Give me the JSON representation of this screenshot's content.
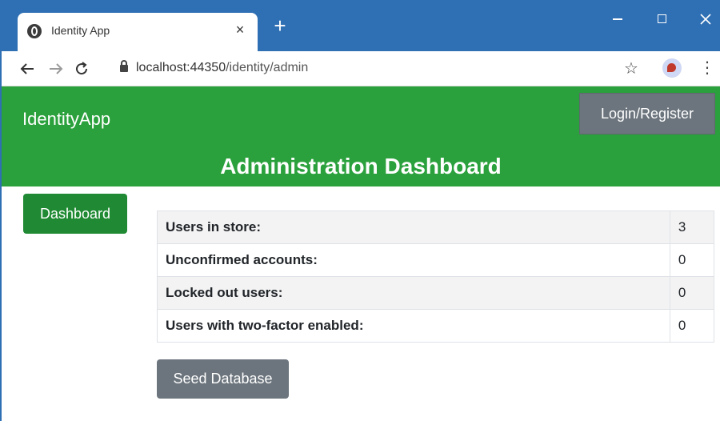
{
  "browser": {
    "tab_title": "Identity App",
    "tab_close": "×",
    "new_tab": "+",
    "url_host": "localhost:44350",
    "url_path": "/identity/admin",
    "icons": [
      "globe-icon",
      "close-icon",
      "plus-icon",
      "minimize-icon",
      "maximize-icon",
      "window-close-icon",
      "back-arrow-icon",
      "forward-arrow-icon",
      "reload-icon",
      "lock-icon",
      "star-icon",
      "profile-icon",
      "kebab-menu-icon"
    ]
  },
  "header": {
    "brand": "IdentityApp",
    "login_label": "Login/Register",
    "title": "Administration Dashboard",
    "color": "#2aa13c"
  },
  "sidebar": {
    "items": [
      {
        "label": "Dashboard"
      }
    ]
  },
  "stats": {
    "rows": [
      {
        "label": "Users in store:",
        "value": "3"
      },
      {
        "label": "Unconfirmed accounts:",
        "value": "0"
      },
      {
        "label": "Locked out users:",
        "value": "0"
      },
      {
        "label": "Users with two-factor enabled:",
        "value": "0"
      }
    ]
  },
  "actions": {
    "seed_label": "Seed Database"
  }
}
